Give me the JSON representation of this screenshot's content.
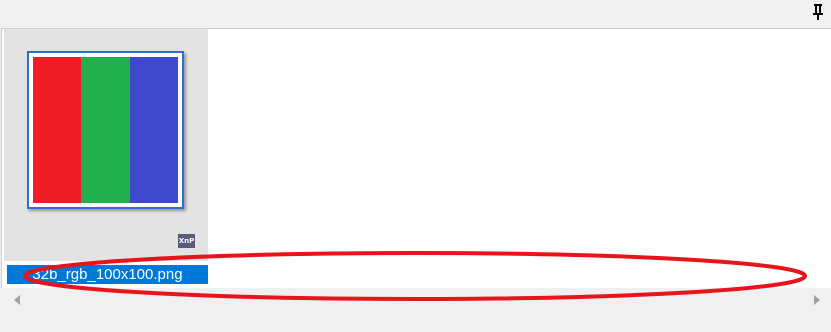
{
  "file": {
    "name": "32b_rgb_100x100.png",
    "badge_text": "XnP"
  },
  "thumbnail": {
    "stripes": [
      "#ee1c25",
      "#22b14c",
      "#3f48cc"
    ]
  },
  "colors": {
    "selection": "#0078d7",
    "annotation": "#e8141c",
    "frame": "#2f6fd2"
  },
  "icons": {
    "pin": "pin-icon",
    "scroll_left": "scroll-left-arrow-icon",
    "scroll_right": "scroll-right-arrow-icon"
  }
}
